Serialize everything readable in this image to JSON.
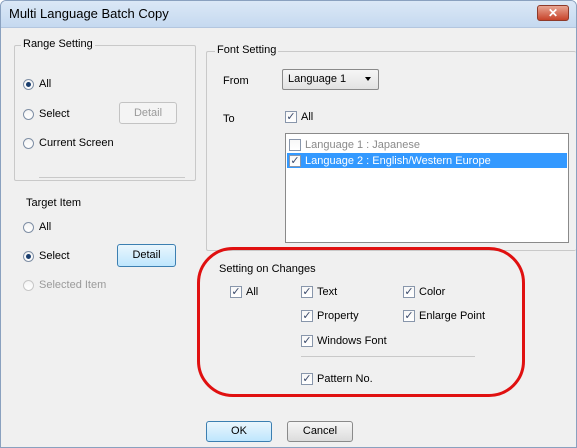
{
  "window": {
    "title": "Multi Language Batch Copy",
    "close_label": "✕"
  },
  "range_setting": {
    "legend": "Range Setting",
    "all_label": "All",
    "select_label": "Select",
    "detail_label": "Detail",
    "current_screen_label": "Current Screen",
    "selected": "All"
  },
  "target_item": {
    "legend": "Target Item",
    "all_label": "All",
    "select_label": "Select",
    "detail_label": "Detail",
    "selected_item_label": "Selected Item",
    "selected": "Select"
  },
  "font_setting": {
    "legend": "Font Setting",
    "from_label": "From",
    "from_value": "Language 1",
    "to_label": "To",
    "to_all_label": "All",
    "languages": [
      {
        "label": "Language 1 : Japanese",
        "checked": false,
        "enabled": false
      },
      {
        "label": "Language 2 : English/Western Europe",
        "checked": true,
        "enabled": true
      }
    ]
  },
  "setting_on_changes": {
    "legend": "Setting on Changes",
    "all_label": "All",
    "text_label": "Text",
    "color_label": "Color",
    "property_label": "Property",
    "enlarge_point_label": "Enlarge Point",
    "windows_font_label": "Windows Font",
    "pattern_no_label": "Pattern No."
  },
  "footer": {
    "ok_label": "OK",
    "cancel_label": "Cancel"
  },
  "colors": {
    "highlight": "#3399ff",
    "annotation_oval": "#e01010"
  }
}
